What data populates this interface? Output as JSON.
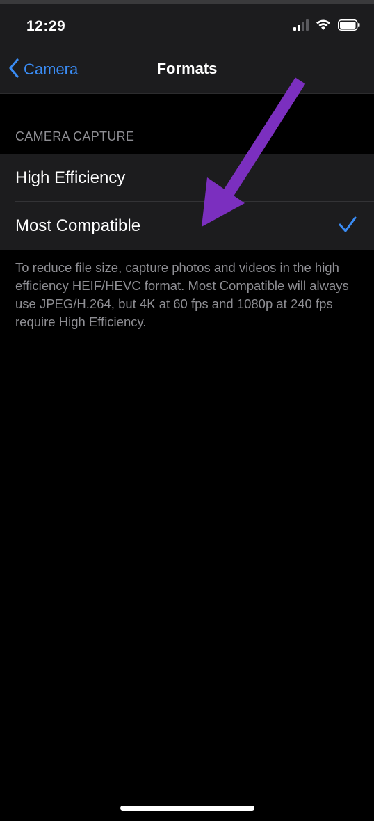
{
  "status_bar": {
    "time": "12:29"
  },
  "nav": {
    "back_label": "Camera",
    "title": "Formats"
  },
  "section": {
    "header": "CAMERA CAPTURE",
    "options": [
      {
        "label": "High Efficiency",
        "selected": false
      },
      {
        "label": "Most Compatible",
        "selected": true
      }
    ],
    "footer": "To reduce file size, capture photos and videos in the high efficiency HEIF/HEVC format. Most Compatible will always use JPEG/H.264, but 4K at 60 fps and 1080p at 240 fps require High Efficiency."
  },
  "icons": {
    "back": "chevron-left-icon",
    "check": "checkmark-icon",
    "signal": "cellular-signal-icon",
    "wifi": "wifi-icon",
    "battery": "battery-icon",
    "annotation": "arrow-annotation"
  },
  "colors": {
    "accent": "#3a8cf5",
    "background": "#000000",
    "cell": "#1c1c1e",
    "secondary_text": "#8e8e93",
    "arrow": "#7b2fbf"
  }
}
